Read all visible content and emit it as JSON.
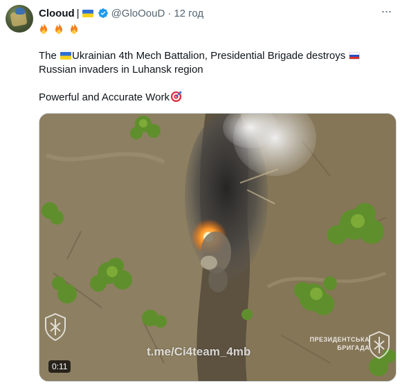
{
  "tweet": {
    "display_name": "Clooud",
    "separator": "|",
    "handle": "@GloOouD",
    "dot": "·",
    "time": "12 год",
    "text_line1_a": "The ",
    "text_line1_b": "Ukrainian 4th Mech Battalion, Presidential Brigade destroys ",
    "text_line1_c": "Russian invaders in Luhansk region",
    "text_line2": "Powerful and Accurate Work",
    "more_label": "···"
  },
  "media": {
    "duration": "0:11",
    "watermark_link": "t.me/Ci4team_4mb",
    "watermark_brand_line1": "ПРЕЗИДЕНТСЬКА",
    "watermark_brand_line2": "БРИГАДА"
  },
  "colors": {
    "accent": "#1d9bf0",
    "secondary_text": "#536471",
    "primary_text": "#0f1419"
  },
  "icons": [
    "avatar",
    "ukraine-flag-icon",
    "verified-icon",
    "more-icon",
    "fire-icon",
    "russia-flag-icon",
    "target-icon"
  ]
}
